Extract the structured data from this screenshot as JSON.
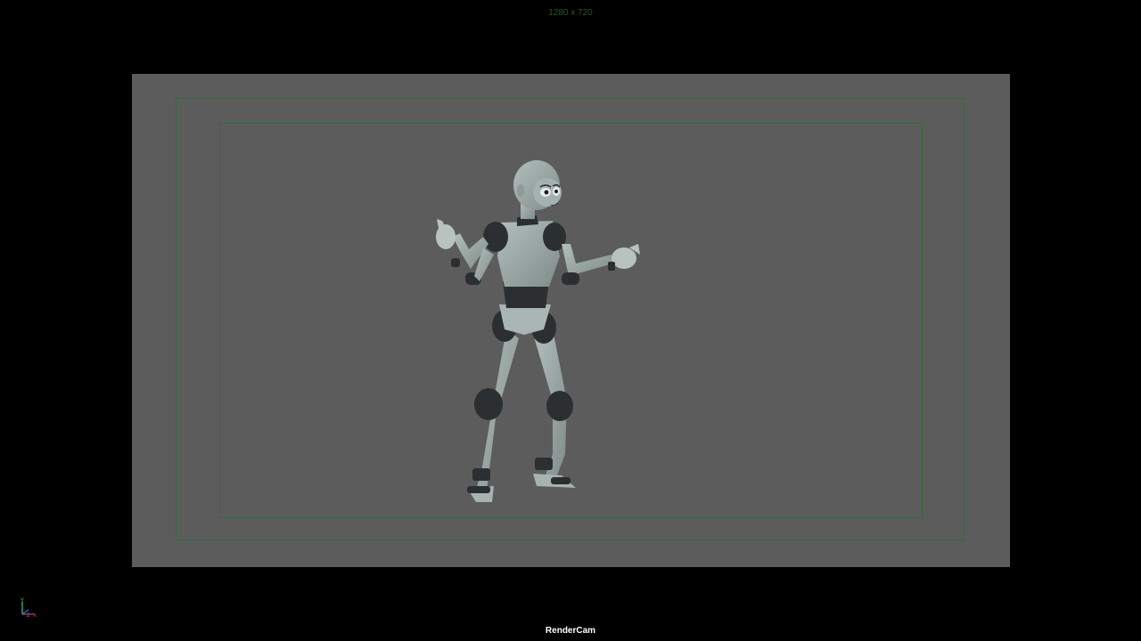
{
  "viewport": {
    "resolution_label": "1280 x 720",
    "camera_label": "RenderCam",
    "axis": {
      "y_label": "Y",
      "x_label": "X",
      "z_label": "Z"
    },
    "colors": {
      "background": "#000000",
      "film_gate": "#5c5c5c",
      "safe_frame_lines": "#2d6d3c",
      "resolution_text": "#1f5a2d",
      "camera_text": "#ffffff",
      "character_skin": "#9aa7a4",
      "character_pads": "#2b2f31"
    },
    "icons": {
      "axis_gizmo": "xyz-axis-icon",
      "character": "3d-character-model"
    }
  }
}
